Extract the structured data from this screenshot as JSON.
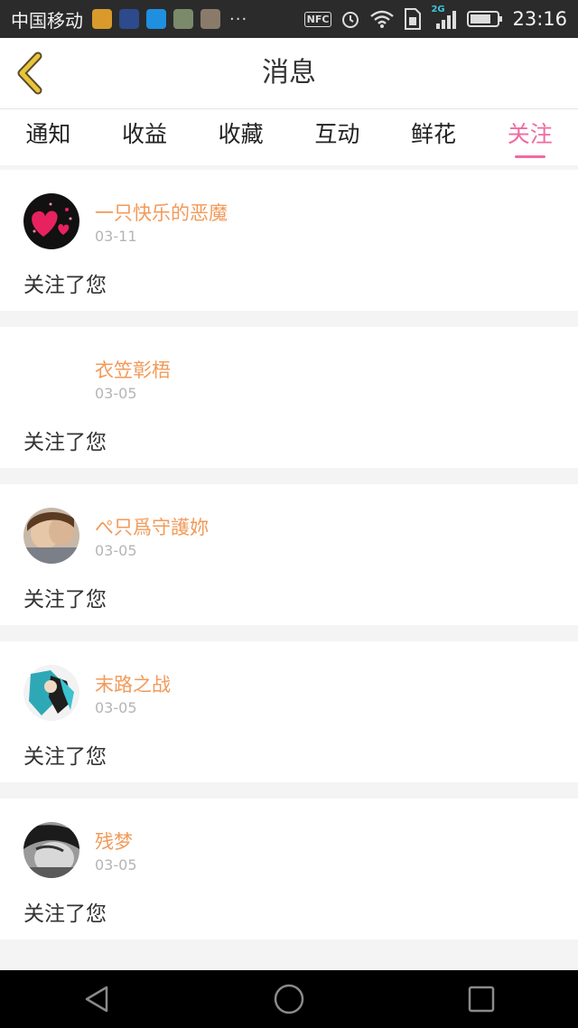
{
  "status_bar": {
    "carrier": "中国移动",
    "overflow": "···",
    "nfc": "NFC",
    "network": "2G",
    "time": "23:16"
  },
  "header": {
    "title": "消息",
    "back_icon": "chevron-left-icon"
  },
  "tabs": [
    {
      "label": "通知",
      "active": false
    },
    {
      "label": "收益",
      "active": false
    },
    {
      "label": "收藏",
      "active": false
    },
    {
      "label": "互动",
      "active": false
    },
    {
      "label": "鲜花",
      "active": false
    },
    {
      "label": "关注",
      "active": true
    }
  ],
  "messages": [
    {
      "username": "一只快乐的恶魔",
      "date": "03-11",
      "text": "关注了您"
    },
    {
      "username": "衣笠彰梧",
      "date": "03-05",
      "text": "关注了您"
    },
    {
      "username": "ぺ只爲守護妳",
      "date": "03-05",
      "text": "关注了您"
    },
    {
      "username": "末路之战",
      "date": "03-05",
      "text": "关注了您"
    },
    {
      "username": "残梦",
      "date": "03-05",
      "text": "关注了您"
    }
  ],
  "colors": {
    "accent_pink": "#ef6ba0",
    "username_orange": "#f29a5a",
    "date_gray": "#b5b5b5",
    "back_chevron": "#e8c53a"
  },
  "nav": [
    "back-triangle-icon",
    "home-circle-icon",
    "recents-square-icon"
  ]
}
